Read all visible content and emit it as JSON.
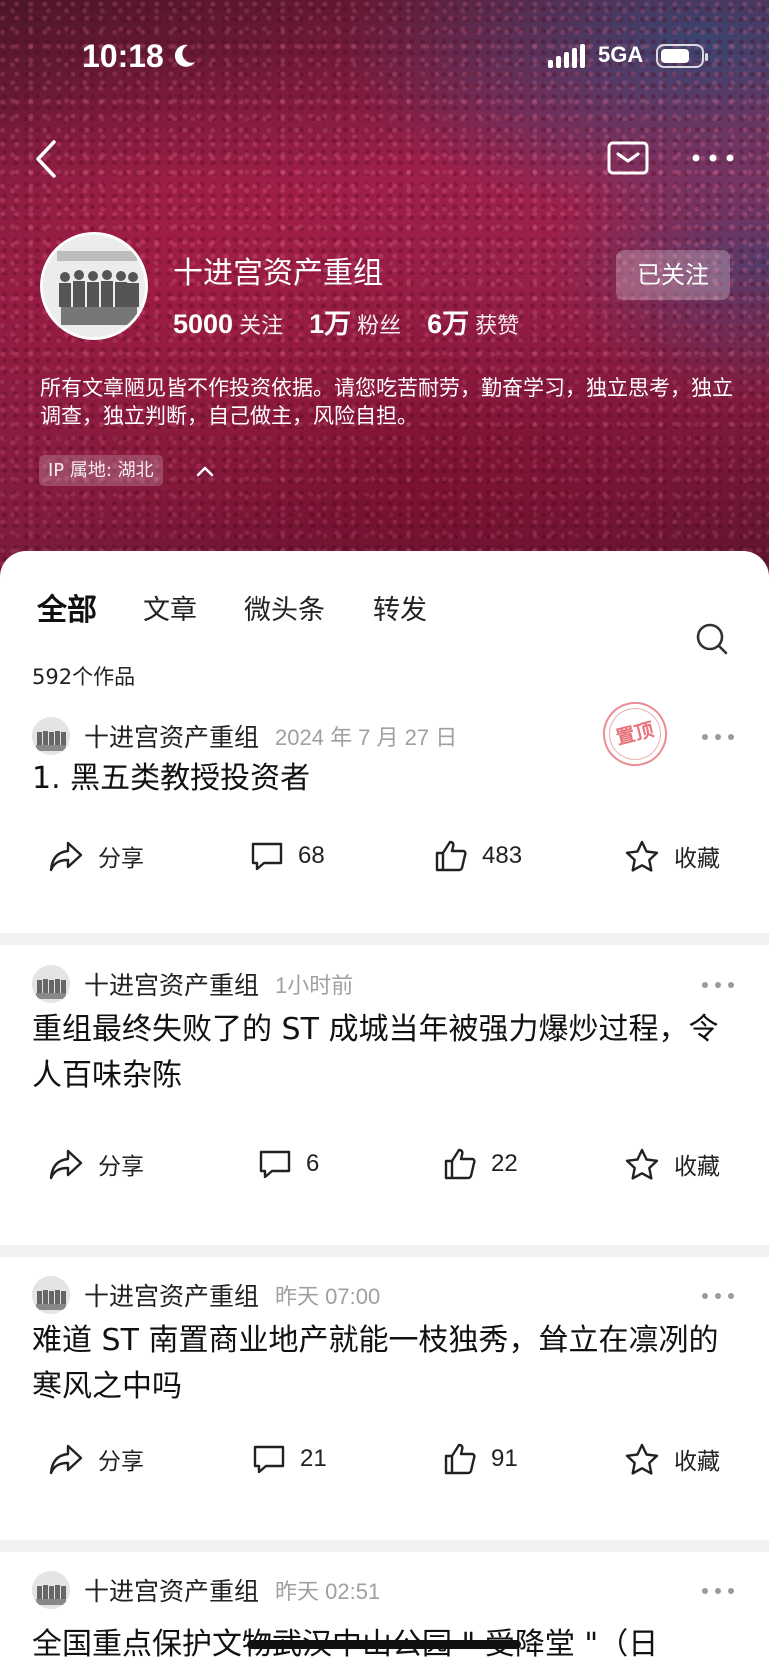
{
  "status_bar": {
    "time": "10:18",
    "network": "5GA"
  },
  "profile": {
    "name": "十进宫资产重组",
    "follow_button": "已关注",
    "stats": [
      {
        "num": "5000",
        "label": "关注"
      },
      {
        "num": "1万",
        "label": "粉丝"
      },
      {
        "num": "6万",
        "label": "获赞"
      }
    ],
    "bio": "所有文章陋见皆不作投资依据。请您吃苦耐劳，勤奋学习，独立思考，独立调查，独立判断，自己做主，风险自担。",
    "ip_location": "IP 属地: 湖北"
  },
  "tabs": [
    "全部",
    "文章",
    "微头条",
    "转发"
  ],
  "works_count": "592个作品",
  "posts": [
    {
      "author": "十进宫资产重组",
      "time": "2024 年 7 月 27 日",
      "pinned_label": "置顶",
      "title": "1. 黑五类教授投资者",
      "share_label": "分享",
      "comments": "68",
      "likes": "483",
      "collect_label": "收藏"
    },
    {
      "author": "十进宫资产重组",
      "time": "1小时前",
      "title": "重组最终失败了的 ST 成城当年被强力爆炒过程，令人百味杂陈",
      "share_label": "分享",
      "comments": "6",
      "likes": "22",
      "collect_label": "收藏"
    },
    {
      "author": "十进宫资产重组",
      "time": "昨天 07:00",
      "title": "难道 ST 南置商业地产就能一枝独秀，耸立在凛冽的寒风之中吗",
      "share_label": "分享",
      "comments": "21",
      "likes": "91",
      "collect_label": "收藏"
    },
    {
      "author": "十进宫资产重组",
      "time": "昨天 02:51",
      "title": "全国重点保护文物武汉中山公园 \" 受降堂 \"（日"
    }
  ]
}
